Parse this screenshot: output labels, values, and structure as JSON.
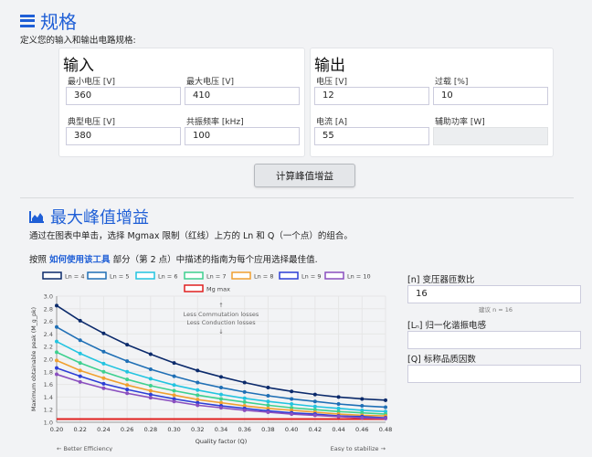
{
  "spec": {
    "title": "规格",
    "description": "定义您的输入和输出电路规格:"
  },
  "input_card": {
    "title": "输入",
    "min_voltage": {
      "label": "最小电压 [V]",
      "value": "360"
    },
    "max_voltage": {
      "label": "最大电压 [V]",
      "value": "410"
    },
    "typ_voltage": {
      "label": "典型电压 [V]",
      "value": "380"
    },
    "res_freq": {
      "label": "共振频率 [kHz]",
      "value": "100"
    }
  },
  "output_card": {
    "title": "输出",
    "voltage": {
      "label": "电压 [V]",
      "value": "12"
    },
    "overload": {
      "label": "过载 [%]",
      "value": "10"
    },
    "current": {
      "label": "电流 [A]",
      "value": "55"
    },
    "aux_power": {
      "label": "辅助功率 [W]",
      "value": ""
    }
  },
  "calc_button": "计算峰值增益",
  "gain": {
    "title": "最大峰值增益",
    "desc1": "通过在图表中单击，选择 Mgmax 限制（红线）上方的 Ln 和 Q（一个点）的组合。",
    "desc2_pre": "按照 ",
    "desc2_link": "如何使用该工具",
    "desc2_post": " 部分（第 2 点）中描述的指南为每个应用选择最佳值."
  },
  "side": {
    "n_label": "[n] 变压器匝数比",
    "n_value": "16",
    "n_hint": "建议 n = 16",
    "ln_label": "[Lₙ] 归一化谐振电感",
    "ln_value": "",
    "q_label": "[Q] 标称品质因数",
    "q_value": ""
  },
  "chart_data": {
    "type": "line",
    "xlabel": "Quality factor (Q)",
    "ylabel": "Maximum obtainable peak (M_g_pk)",
    "xlim": [
      0.2,
      0.48
    ],
    "ylim": [
      1.0,
      3.0
    ],
    "x_ticks": [
      "0.20",
      "0.22",
      "0.24",
      "0.26",
      "0.28",
      "0.30",
      "0.32",
      "0.34",
      "0.36",
      "0.38",
      "0.40",
      "0.42",
      "0.44",
      "0.46",
      "0.48"
    ],
    "y_ticks": [
      "1.0",
      "1.2",
      "1.4",
      "1.6",
      "1.8",
      "2.0",
      "2.2",
      "2.4",
      "2.6",
      "2.8",
      "3.0"
    ],
    "annotation_top_1": "Less Commutation losses",
    "annotation_top_2": "Less Conduction losses",
    "annotation_left": "← Better Efficiency",
    "annotation_right": "Easy to stabilize →",
    "x": [
      0.2,
      0.22,
      0.24,
      0.26,
      0.28,
      0.3,
      0.32,
      0.34,
      0.36,
      0.38,
      0.4,
      0.42,
      0.44,
      0.46,
      0.48
    ],
    "series": [
      {
        "name": "Ln = 4",
        "color": "#0b2a6b",
        "values": [
          2.85,
          2.61,
          2.41,
          2.23,
          2.08,
          1.94,
          1.82,
          1.72,
          1.63,
          1.55,
          1.49,
          1.44,
          1.4,
          1.37,
          1.35
        ]
      },
      {
        "name": "Ln = 5",
        "color": "#1f6fb5",
        "values": [
          2.51,
          2.3,
          2.12,
          1.97,
          1.84,
          1.73,
          1.63,
          1.55,
          1.48,
          1.42,
          1.37,
          1.33,
          1.29,
          1.26,
          1.24
        ]
      },
      {
        "name": "Ln = 6",
        "color": "#22c4e0",
        "values": [
          2.28,
          2.09,
          1.93,
          1.8,
          1.69,
          1.59,
          1.51,
          1.44,
          1.38,
          1.33,
          1.29,
          1.25,
          1.22,
          1.19,
          1.17
        ]
      },
      {
        "name": "Ln = 7",
        "color": "#3ed08f",
        "values": [
          2.11,
          1.94,
          1.8,
          1.68,
          1.58,
          1.5,
          1.43,
          1.37,
          1.32,
          1.27,
          1.23,
          1.2,
          1.17,
          1.15,
          1.13
        ]
      },
      {
        "name": "Ln = 8",
        "color": "#f0a030",
        "values": [
          1.98,
          1.82,
          1.7,
          1.59,
          1.5,
          1.43,
          1.36,
          1.31,
          1.26,
          1.22,
          1.19,
          1.16,
          1.13,
          1.11,
          1.1
        ]
      },
      {
        "name": "Ln = 9",
        "color": "#2c3fd6",
        "values": [
          1.86,
          1.73,
          1.61,
          1.52,
          1.44,
          1.37,
          1.31,
          1.26,
          1.22,
          1.18,
          1.15,
          1.13,
          1.1,
          1.09,
          1.07
        ]
      },
      {
        "name": "Ln = 10",
        "color": "#8a4fbf",
        "values": [
          1.76,
          1.64,
          1.54,
          1.46,
          1.39,
          1.33,
          1.27,
          1.23,
          1.19,
          1.16,
          1.13,
          1.11,
          1.09,
          1.07,
          1.06
        ]
      }
    ],
    "limit": {
      "name": "Mg max",
      "color": "#e02020",
      "value": 1.05
    }
  }
}
